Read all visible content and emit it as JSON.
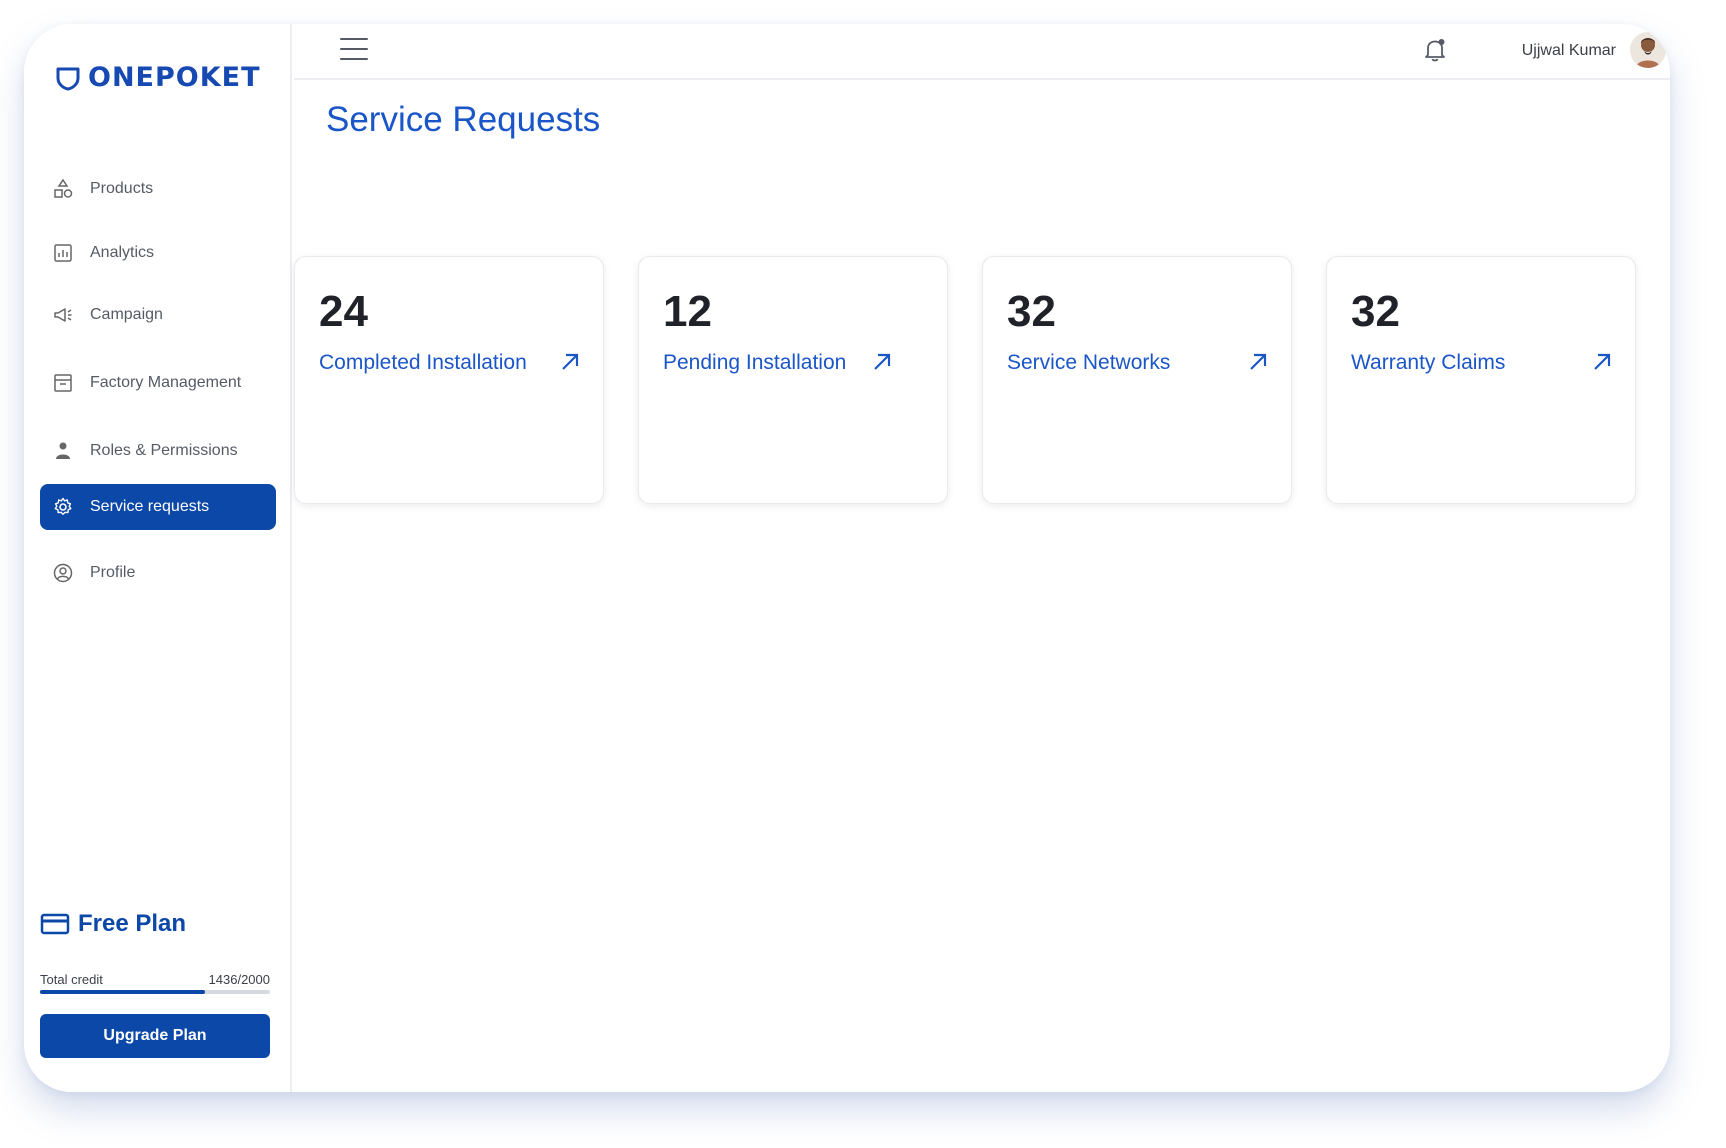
{
  "brand": {
    "name": "ONEPOKET",
    "color": "#1649b2"
  },
  "sidebar": {
    "items": [
      {
        "label": "Products",
        "icon": "shapes-icon",
        "active": false
      },
      {
        "label": "Analytics",
        "icon": "chart-icon",
        "active": false
      },
      {
        "label": "Campaign",
        "icon": "megaphone-icon",
        "active": false
      },
      {
        "label": "Factory Management",
        "icon": "archive-box-icon",
        "active": false
      },
      {
        "label": "Roles & Permissions",
        "icon": "person-icon",
        "active": false
      },
      {
        "label": "Service requests",
        "icon": "gear-icon",
        "active": true
      },
      {
        "label": "Profile",
        "icon": "user-circle-icon",
        "active": false
      }
    ],
    "plan": {
      "title": "Free Plan",
      "credit_label": "Total credit",
      "credit_value": "1436/2000",
      "credit_fraction": 0.718,
      "upgrade_label": "Upgrade Plan"
    }
  },
  "topbar": {
    "user_name": "Ujjwal Kumar"
  },
  "main": {
    "title": "Service Requests",
    "cards": [
      {
        "count": "24",
        "label": "Completed Installation"
      },
      {
        "count": "12",
        "label": "Pending Installation"
      },
      {
        "count": "32",
        "label": "Service Networks"
      },
      {
        "count": "32",
        "label": "Warranty Claims"
      }
    ]
  },
  "colors": {
    "primary": "#0b48a8",
    "accent_text": "#1a56c8"
  }
}
